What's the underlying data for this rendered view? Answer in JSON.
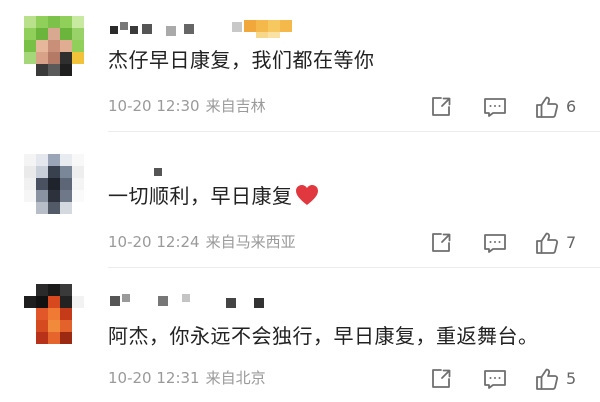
{
  "comments": [
    {
      "content": "杰仔早日康复，我们都在等你",
      "time": "10-20 12:30",
      "location": "来自吉林",
      "likes": "6",
      "icons": [
        "share-icon",
        "reply-icon",
        "thumbs-up-icon"
      ]
    },
    {
      "content": "一切顺利，早日康复",
      "emoji": "red-heart-emoji",
      "time": "10-20 12:24",
      "location": "来自马来西亚",
      "likes": "7",
      "icons": [
        "share-icon",
        "reply-icon",
        "thumbs-up-icon"
      ]
    },
    {
      "content": "阿杰，你永远不会独行，早日康复，重返舞台。",
      "time": "10-20 12:31",
      "location": "来自北京",
      "likes": "5",
      "icons": [
        "share-icon",
        "reply-icon",
        "thumbs-up-icon"
      ]
    }
  ],
  "colors": {
    "text": "#222222",
    "meta": "#9a9a9a",
    "icon": "#6f6f6f",
    "divider": "#ececec",
    "heart": "#e0383e"
  }
}
